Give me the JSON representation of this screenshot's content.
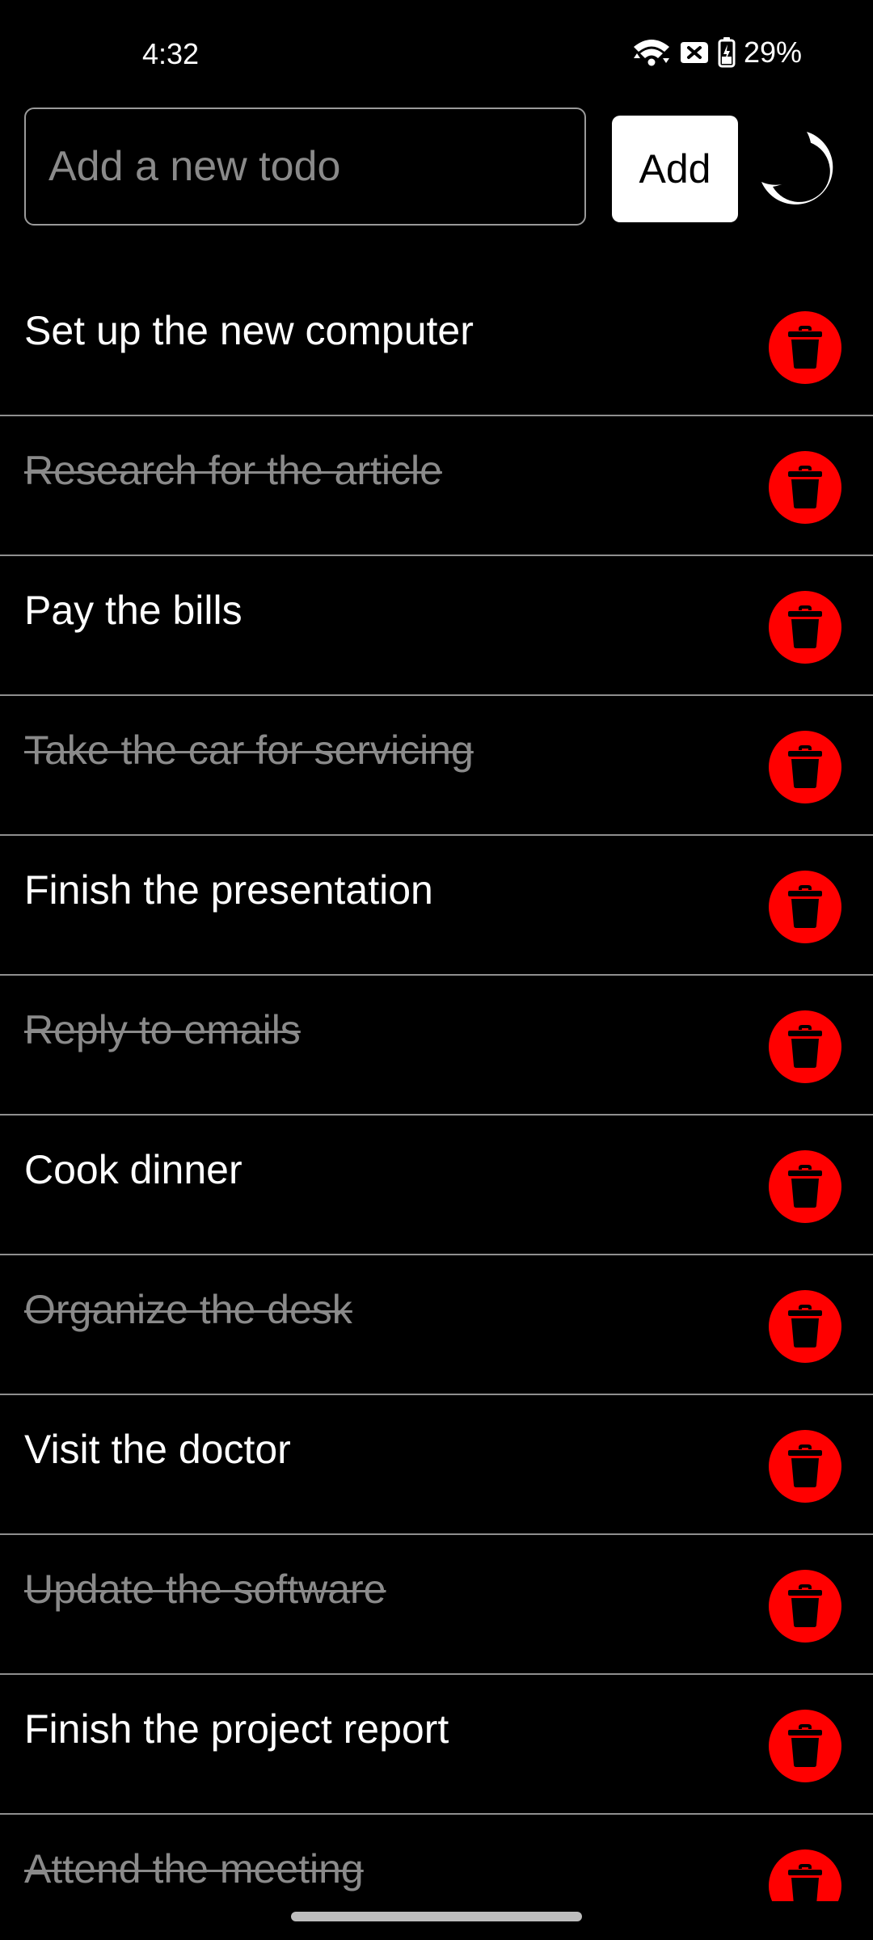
{
  "status_bar": {
    "time": "4:32",
    "battery_percent": "29%",
    "icons": [
      "wifi-icon",
      "no-sim-icon",
      "battery-charging-icon"
    ]
  },
  "input": {
    "placeholder": "Add a new todo",
    "value": ""
  },
  "add_button": {
    "label": "Add"
  },
  "theme_toggle": {
    "icon": "moon-icon"
  },
  "colors": {
    "background": "#000000",
    "text": "#ffffff",
    "done_text": "#8a8a8a",
    "delete": "#ff0000",
    "divider": "#8f8f8f"
  },
  "todos": [
    {
      "text": "Set up the new computer",
      "done": false
    },
    {
      "text": "Research for the article",
      "done": true
    },
    {
      "text": "Pay the bills",
      "done": false
    },
    {
      "text": "Take the car for servicing",
      "done": true
    },
    {
      "text": "Finish the presentation",
      "done": false
    },
    {
      "text": "Reply to emails",
      "done": true
    },
    {
      "text": "Cook dinner",
      "done": false
    },
    {
      "text": "Organize the desk",
      "done": true
    },
    {
      "text": "Visit the doctor",
      "done": false
    },
    {
      "text": "Update the software",
      "done": true
    },
    {
      "text": "Finish the project report",
      "done": false
    },
    {
      "text": "Attend the meeting",
      "done": true
    }
  ]
}
